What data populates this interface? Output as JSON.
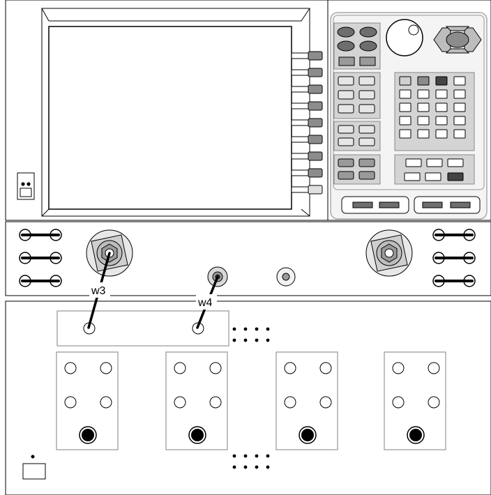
{
  "cable_labels": {
    "w3": "w3",
    "w4": "w4"
  },
  "colors": {
    "outline": "#000000",
    "panel_border": "#b0b0b0",
    "key_dark": "#6e6e6e",
    "key_mid": "#9a9a9a",
    "key_light": "#e6e6e6",
    "softkey": "#8c8c8c",
    "background": "#ffffff"
  },
  "icons": {
    "front_panel_knob": "rotary-knob-icon",
    "arrow_keys": "navigation-arrows-icon",
    "port_connector": "rf-port-connector-icon",
    "cable": "cable-icon"
  }
}
